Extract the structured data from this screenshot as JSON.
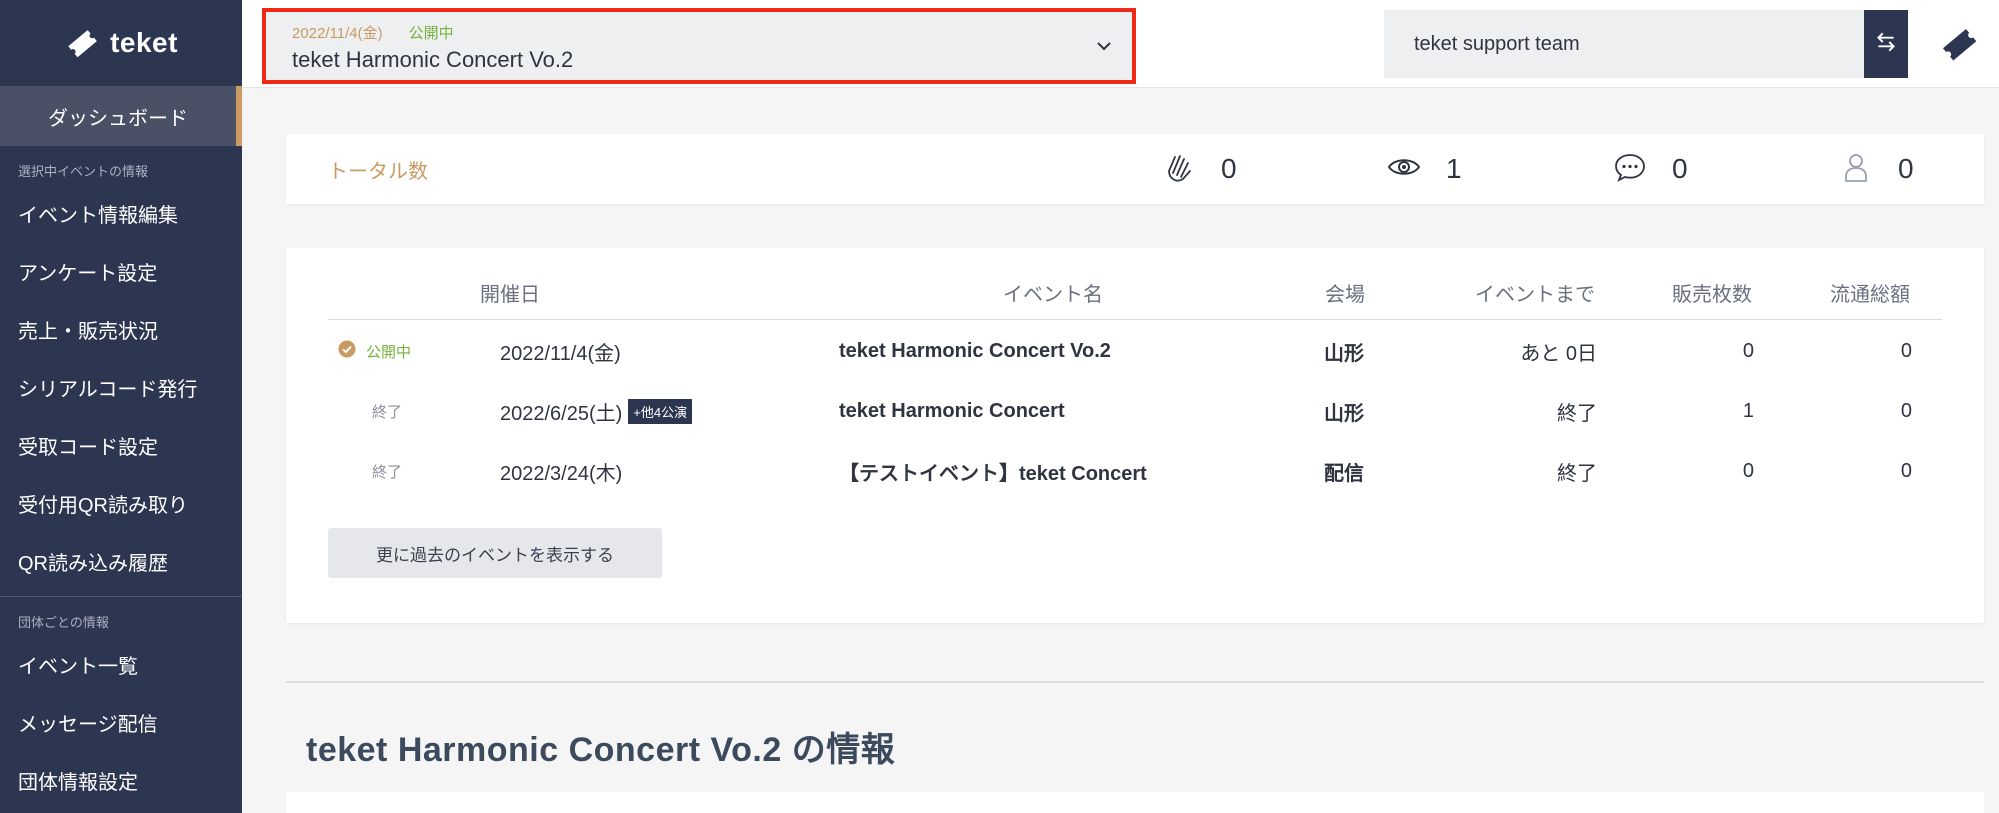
{
  "brand": {
    "name": "teket"
  },
  "sidebar": {
    "dashboard": "ダッシュボード",
    "section_event": "選択中イベントの情報",
    "event_items": [
      {
        "label": "イベント情報編集"
      },
      {
        "label": "アンケート設定"
      },
      {
        "label": "売上・販売状況"
      },
      {
        "label": "シリアルコード発行"
      },
      {
        "label": "受取コード設定"
      },
      {
        "label": "受付用QR読み取り"
      },
      {
        "label": "QR読み込み履歴"
      }
    ],
    "section_org": "団体ごとの情報",
    "org_items": [
      {
        "label": "イベント一覧"
      },
      {
        "label": "メッセージ配信"
      },
      {
        "label": "団体情報設定"
      }
    ]
  },
  "header": {
    "selected_event": {
      "date": "2022/11/4(金)",
      "status": "公開中",
      "title": "teket Harmonic Concert Vo.2"
    },
    "team": "teket support team"
  },
  "totals": {
    "label": "トータル数",
    "stats": [
      {
        "icon": "clap-icon",
        "value": "0"
      },
      {
        "icon": "eye-icon",
        "value": "1"
      },
      {
        "icon": "comment-icon",
        "value": "0"
      },
      {
        "icon": "user-icon",
        "value": "0"
      }
    ]
  },
  "events_table": {
    "columns": {
      "date": "開催日",
      "name": "イベント名",
      "venue": "会場",
      "until": "イベントまで",
      "sold": "販売枚数",
      "total": "流通総額"
    },
    "rows": [
      {
        "status": "公開中",
        "date": "2022/11/4(金)",
        "badge": "",
        "name": "teket Harmonic Concert Vo.2",
        "venue": "山形",
        "until": "あと 0日",
        "sold": "0",
        "total": "0"
      },
      {
        "status": "終了",
        "date": "2022/6/25(土)",
        "badge": "+他4公演",
        "name": "teket Harmonic Concert",
        "venue": "山形",
        "until": "終了",
        "sold": "1",
        "total": "0"
      },
      {
        "status": "終了",
        "date": "2022/3/24(木)",
        "badge": "",
        "name": "【テストイベント】teket Concert",
        "venue": "配信",
        "until": "終了",
        "sold": "0",
        "total": "0"
      }
    ],
    "more_button": "更に過去のイベントを表示する"
  },
  "info_section": {
    "title": "teket Harmonic Concert Vo.2 の情報"
  },
  "colors": {
    "sidebar": "#2d3651",
    "accent_gold": "#c99a62",
    "status_green": "#78b240",
    "highlight_red": "#ee2a16"
  }
}
